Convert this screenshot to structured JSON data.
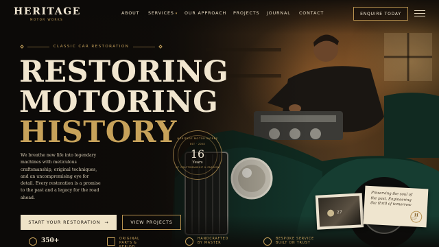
{
  "brand": {
    "name": "HERITAGE",
    "tagline": "MOTOR WORKS"
  },
  "nav": {
    "items": [
      {
        "label": "ABOUT"
      },
      {
        "label": "SERVICES",
        "has_dropdown": true
      },
      {
        "label": "OUR APPROACH"
      },
      {
        "label": "PROJECTS"
      },
      {
        "label": "JOURNAL"
      },
      {
        "label": "CONTACT"
      }
    ],
    "cta_label": "ENQUIRE TODAY",
    "dropdown_glyph": "▾"
  },
  "hero": {
    "eyebrow": "CLASSIC CAR RESTORATION",
    "headline": [
      "RESTORING",
      "MOTORING",
      "HISTORY"
    ],
    "lead": "We breathe new life into legendary machines with meticulous craftsmanship, original techniques, and an uncompromising eye for detail. Every restoration is a promise to the past and a legacy for the road ahead.",
    "primary_cta": "START YOUR RESTORATION",
    "primary_cta_arrow": "→",
    "secondary_cta": "VIEW PROJECTS"
  },
  "badge": {
    "ring_top": "HERITAGE MOTOR WORKS",
    "est": "EST · 2008",
    "number": "16",
    "unit": "Years",
    "ring_bottom": "OF CRAFTSMANSHIP & PASSION"
  },
  "photo": {
    "number": "27"
  },
  "note": {
    "text": "Preserving the soul of the past. Engineering the thrill of tomorrow",
    "seal_letter": "H",
    "seal_text": "HERITAGE MOTOR"
  },
  "stats": [
    {
      "value": "350+",
      "label": ""
    },
    {
      "value": "",
      "label": "ORIGINAL PARTS & PERIOD"
    },
    {
      "value": "",
      "label": "HANDCRAFTED BY MASTER"
    },
    {
      "value": "",
      "label": "BESPOKE SERVICE BUILT ON TRUST"
    }
  ],
  "colors": {
    "accent": "#c6a15b",
    "cream": "#efe3c7",
    "background": "#14110d"
  },
  "icons": [
    "menu-icon",
    "arrow-right-icon",
    "diamond-icon",
    "seal-icon"
  ]
}
